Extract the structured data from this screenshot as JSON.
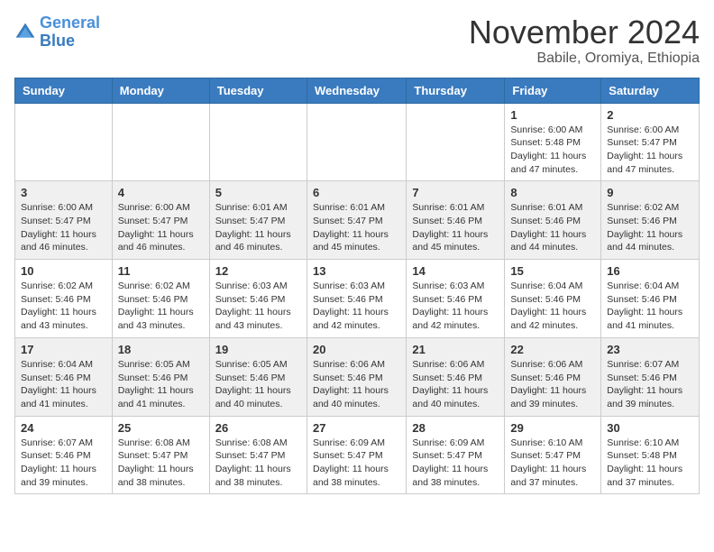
{
  "header": {
    "logo_line1": "General",
    "logo_line2": "Blue",
    "month": "November 2024",
    "location": "Babile, Oromiya, Ethiopia"
  },
  "weekdays": [
    "Sunday",
    "Monday",
    "Tuesday",
    "Wednesday",
    "Thursday",
    "Friday",
    "Saturday"
  ],
  "weeks": [
    [
      {
        "day": "",
        "info": ""
      },
      {
        "day": "",
        "info": ""
      },
      {
        "day": "",
        "info": ""
      },
      {
        "day": "",
        "info": ""
      },
      {
        "day": "",
        "info": ""
      },
      {
        "day": "1",
        "info": "Sunrise: 6:00 AM\nSunset: 5:48 PM\nDaylight: 11 hours and 47 minutes."
      },
      {
        "day": "2",
        "info": "Sunrise: 6:00 AM\nSunset: 5:47 PM\nDaylight: 11 hours and 47 minutes."
      }
    ],
    [
      {
        "day": "3",
        "info": "Sunrise: 6:00 AM\nSunset: 5:47 PM\nDaylight: 11 hours and 46 minutes."
      },
      {
        "day": "4",
        "info": "Sunrise: 6:00 AM\nSunset: 5:47 PM\nDaylight: 11 hours and 46 minutes."
      },
      {
        "day": "5",
        "info": "Sunrise: 6:01 AM\nSunset: 5:47 PM\nDaylight: 11 hours and 46 minutes."
      },
      {
        "day": "6",
        "info": "Sunrise: 6:01 AM\nSunset: 5:47 PM\nDaylight: 11 hours and 45 minutes."
      },
      {
        "day": "7",
        "info": "Sunrise: 6:01 AM\nSunset: 5:46 PM\nDaylight: 11 hours and 45 minutes."
      },
      {
        "day": "8",
        "info": "Sunrise: 6:01 AM\nSunset: 5:46 PM\nDaylight: 11 hours and 44 minutes."
      },
      {
        "day": "9",
        "info": "Sunrise: 6:02 AM\nSunset: 5:46 PM\nDaylight: 11 hours and 44 minutes."
      }
    ],
    [
      {
        "day": "10",
        "info": "Sunrise: 6:02 AM\nSunset: 5:46 PM\nDaylight: 11 hours and 43 minutes."
      },
      {
        "day": "11",
        "info": "Sunrise: 6:02 AM\nSunset: 5:46 PM\nDaylight: 11 hours and 43 minutes."
      },
      {
        "day": "12",
        "info": "Sunrise: 6:03 AM\nSunset: 5:46 PM\nDaylight: 11 hours and 43 minutes."
      },
      {
        "day": "13",
        "info": "Sunrise: 6:03 AM\nSunset: 5:46 PM\nDaylight: 11 hours and 42 minutes."
      },
      {
        "day": "14",
        "info": "Sunrise: 6:03 AM\nSunset: 5:46 PM\nDaylight: 11 hours and 42 minutes."
      },
      {
        "day": "15",
        "info": "Sunrise: 6:04 AM\nSunset: 5:46 PM\nDaylight: 11 hours and 42 minutes."
      },
      {
        "day": "16",
        "info": "Sunrise: 6:04 AM\nSunset: 5:46 PM\nDaylight: 11 hours and 41 minutes."
      }
    ],
    [
      {
        "day": "17",
        "info": "Sunrise: 6:04 AM\nSunset: 5:46 PM\nDaylight: 11 hours and 41 minutes."
      },
      {
        "day": "18",
        "info": "Sunrise: 6:05 AM\nSunset: 5:46 PM\nDaylight: 11 hours and 41 minutes."
      },
      {
        "day": "19",
        "info": "Sunrise: 6:05 AM\nSunset: 5:46 PM\nDaylight: 11 hours and 40 minutes."
      },
      {
        "day": "20",
        "info": "Sunrise: 6:06 AM\nSunset: 5:46 PM\nDaylight: 11 hours and 40 minutes."
      },
      {
        "day": "21",
        "info": "Sunrise: 6:06 AM\nSunset: 5:46 PM\nDaylight: 11 hours and 40 minutes."
      },
      {
        "day": "22",
        "info": "Sunrise: 6:06 AM\nSunset: 5:46 PM\nDaylight: 11 hours and 39 minutes."
      },
      {
        "day": "23",
        "info": "Sunrise: 6:07 AM\nSunset: 5:46 PM\nDaylight: 11 hours and 39 minutes."
      }
    ],
    [
      {
        "day": "24",
        "info": "Sunrise: 6:07 AM\nSunset: 5:46 PM\nDaylight: 11 hours and 39 minutes."
      },
      {
        "day": "25",
        "info": "Sunrise: 6:08 AM\nSunset: 5:47 PM\nDaylight: 11 hours and 38 minutes."
      },
      {
        "day": "26",
        "info": "Sunrise: 6:08 AM\nSunset: 5:47 PM\nDaylight: 11 hours and 38 minutes."
      },
      {
        "day": "27",
        "info": "Sunrise: 6:09 AM\nSunset: 5:47 PM\nDaylight: 11 hours and 38 minutes."
      },
      {
        "day": "28",
        "info": "Sunrise: 6:09 AM\nSunset: 5:47 PM\nDaylight: 11 hours and 38 minutes."
      },
      {
        "day": "29",
        "info": "Sunrise: 6:10 AM\nSunset: 5:47 PM\nDaylight: 11 hours and 37 minutes."
      },
      {
        "day": "30",
        "info": "Sunrise: 6:10 AM\nSunset: 5:48 PM\nDaylight: 11 hours and 37 minutes."
      }
    ]
  ]
}
